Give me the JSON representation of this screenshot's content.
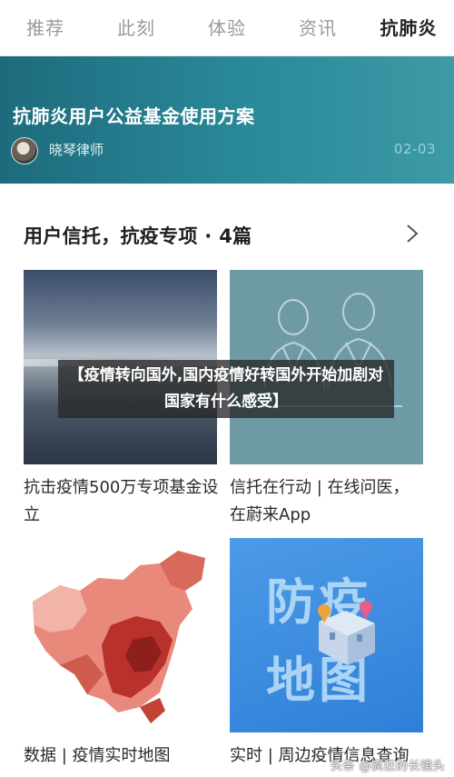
{
  "tabs": [
    {
      "label": "推荐",
      "active": false
    },
    {
      "label": "此刻",
      "active": false
    },
    {
      "label": "体验",
      "active": false
    },
    {
      "label": "资讯",
      "active": false
    },
    {
      "label": "抗肺炎",
      "active": true
    }
  ],
  "banner": {
    "title": "抗肺炎用户公益基金使用方案",
    "author": "晓琴律师",
    "date": "02-03"
  },
  "section": {
    "title": "用户信托，抗疫专项 · 4篇"
  },
  "cards": [
    {
      "caption": "抗击疫情500万专项基金设立"
    },
    {
      "caption": "信托在行动 | 在线问医，在蔚来App"
    },
    {
      "caption": "数据 | 疫情实时地图"
    },
    {
      "caption": "实时 | 周边疫情信息查询"
    }
  ],
  "poster": {
    "line1": "防疫",
    "line2": "地图"
  },
  "overlay": {
    "headline": "【疫情转向国外,国内疫情好转国外开始加剧对国家有什么感受】"
  },
  "watermark": "头条 @疯狂的长镜头",
  "colors": {
    "banner": "#1d6b7c",
    "poster": "#2f7fd8",
    "map": "#c0392b"
  }
}
